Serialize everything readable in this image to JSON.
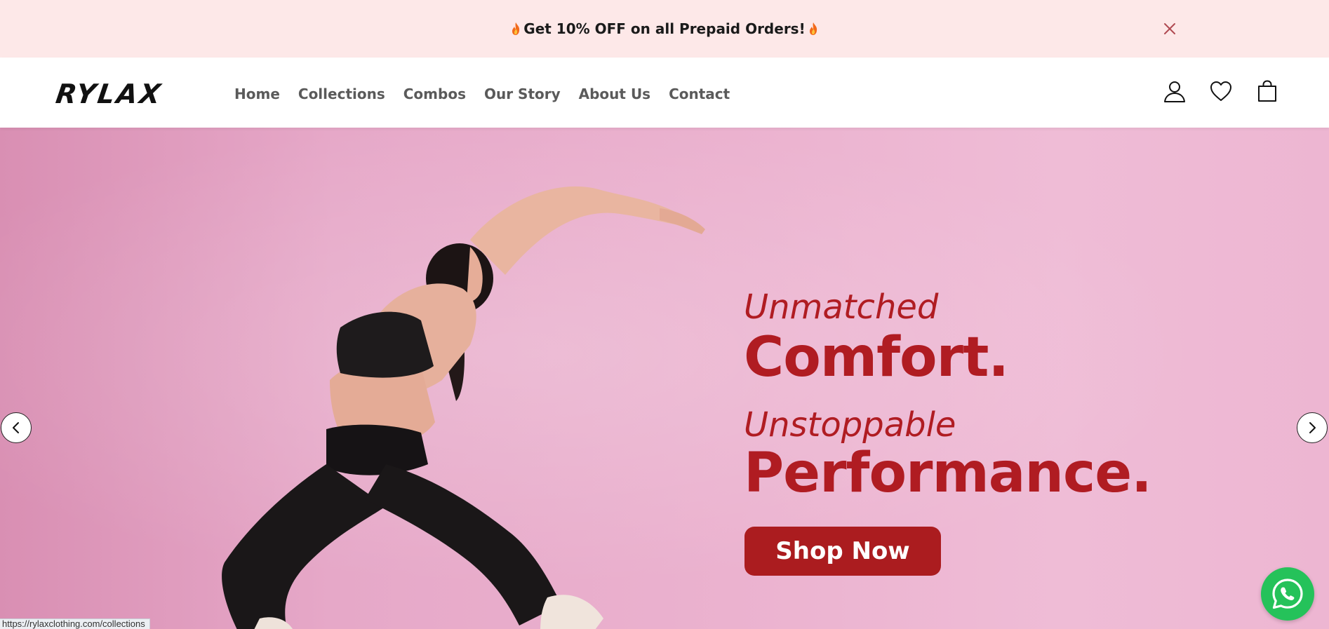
{
  "announcement": {
    "text": "Get 10% OFF on all Prepaid Orders!",
    "icon": "flame-icon",
    "close_icon": "close-icon"
  },
  "header": {
    "logo": "RYLAX",
    "nav": [
      "Home",
      "Collections",
      "Combos",
      "Our Story",
      "About Us",
      "Contact"
    ],
    "icons": [
      "user-icon",
      "heart-icon",
      "shopping-bag-icon"
    ]
  },
  "hero": {
    "line1": "Unmatched",
    "line2": "Comfort.",
    "line3": "Unstoppable",
    "line4": "Performance.",
    "cta": "Shop Now",
    "accent_color": "#b01c22",
    "button_color": "#ab1c1f",
    "background_color": "#ebb2cf"
  },
  "carousel": {
    "prev_icon": "chevron-left-icon",
    "next_icon": "chevron-right-icon"
  },
  "whatsapp": {
    "icon": "whatsapp-icon",
    "color": "#25c25a"
  },
  "status_bar": {
    "url": "https://rylaxclothing.com/collections"
  }
}
